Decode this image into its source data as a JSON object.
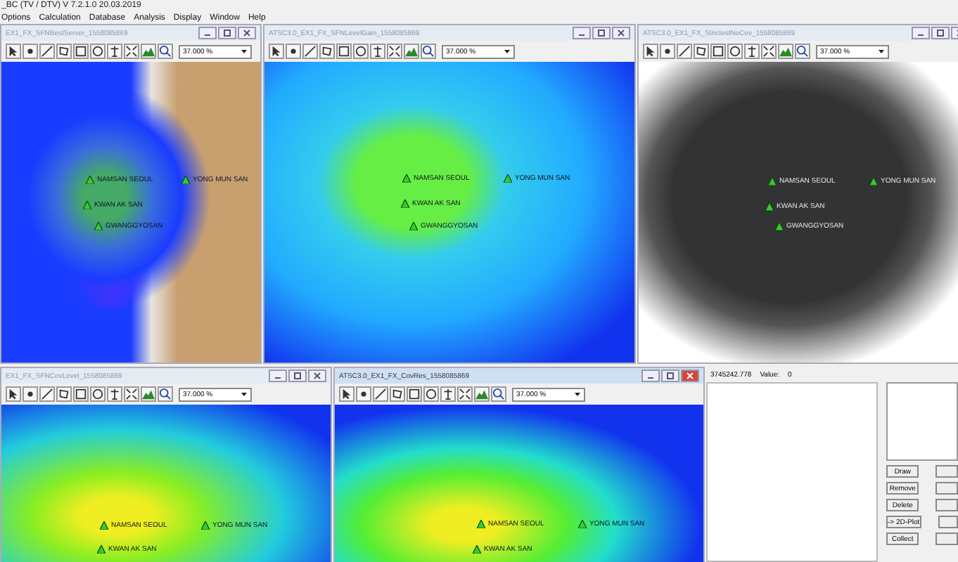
{
  "app": {
    "title": "_BC (TV / DTV)  V 7.2.1.0  20.03.2019"
  },
  "menu": [
    "Options",
    "Calculation",
    "Database",
    "Analysis",
    "Display",
    "Window",
    "Help"
  ],
  "windows": [
    {
      "title": "EX1_FX_SFNBestServer_1558085869",
      "active": false,
      "kind": "best-server",
      "zoom": "37.000 %",
      "stations": [
        "NAMSAN SEOUL",
        "YONG MUN SAN",
        "KWAN AK SAN",
        "GWANGGYOSAN"
      ]
    },
    {
      "title": "ATSC3.0_EX1_FX_SFNLevelGain_1558085869",
      "active": false,
      "kind": "level-gain",
      "zoom": "37.000 %",
      "stations": [
        "NAMSAN SEOUL",
        "YONG MUN SAN",
        "KWAN AK SAN",
        "GWANGGYOSAN"
      ]
    },
    {
      "title": "ATSC3.0_EX1_FX_StrictestNoCov_1558085869",
      "active": false,
      "kind": "no-coverage",
      "zoom": "37.000 %",
      "stations": [
        "NAMSAN SEOUL",
        "YONG MUN SAN",
        "KWAN AK SAN",
        "GWANGGYOSAN"
      ]
    },
    {
      "title": "EX1_FX_SFNCovLevel_1558085869",
      "active": false,
      "kind": "coverage-level",
      "zoom": "37.000 %",
      "stations": [
        "NAMSAN SEOUL",
        "YONG MUN SAN",
        "KWAN AK SAN"
      ]
    },
    {
      "title": "ATSC3.0_EX1_FX_CovRes_1558085869",
      "active": true,
      "kind": "coverage-result",
      "zoom": "37.000 %",
      "stations": [
        "NAMSAN SEOUL",
        "YONG MUN SAN",
        "KWAN AK SAN"
      ]
    }
  ],
  "panel": {
    "status": "3745242.778",
    "value_label": "Value:",
    "value": "0",
    "buttons": [
      "Draw",
      "Remove",
      "Delete",
      "-> 2D-Plot",
      "Collect"
    ]
  }
}
